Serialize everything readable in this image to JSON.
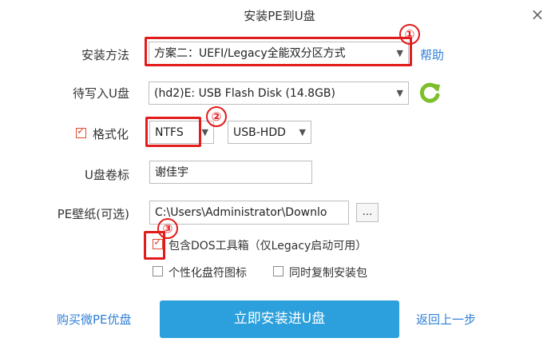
{
  "window": {
    "title": "安装PE到U盘",
    "close_glyph": "×"
  },
  "install_method": {
    "label": "安装方法",
    "value": "方案二：UEFI/Legacy全能双分区方式",
    "help_link": "帮助"
  },
  "target_drive": {
    "label": "待写入U盘",
    "value": "(hd2)E: USB Flash Disk (14.8GB)"
  },
  "format": {
    "label": "格式化",
    "checked": true,
    "fs_value": "NTFS",
    "mode_value": "USB-HDD"
  },
  "volume_label": {
    "label": "U盘卷标",
    "value": "谢佳宇"
  },
  "wallpaper": {
    "label": "PE壁纸(可选)",
    "value": "C:\\Users\\Administrator\\Downlo",
    "browse": "..."
  },
  "options": [
    {
      "label": "包含DOS工具箱（仅Legacy启动可用）",
      "checked": true
    },
    {
      "label": "个性化盘符图标",
      "checked": false
    },
    {
      "label": "同时复制安装包",
      "checked": false
    }
  ],
  "footer": {
    "buy_link": "购买微PE优盘",
    "install_button": "立即安装进U盘",
    "back_link": "返回上一步"
  },
  "annotations": [
    "①",
    "②",
    "③"
  ],
  "colors": {
    "accent": "#2ca0dc",
    "link": "#2f7fd6",
    "annotation": "#e21b1b",
    "refresh": "#7bbf2a"
  }
}
